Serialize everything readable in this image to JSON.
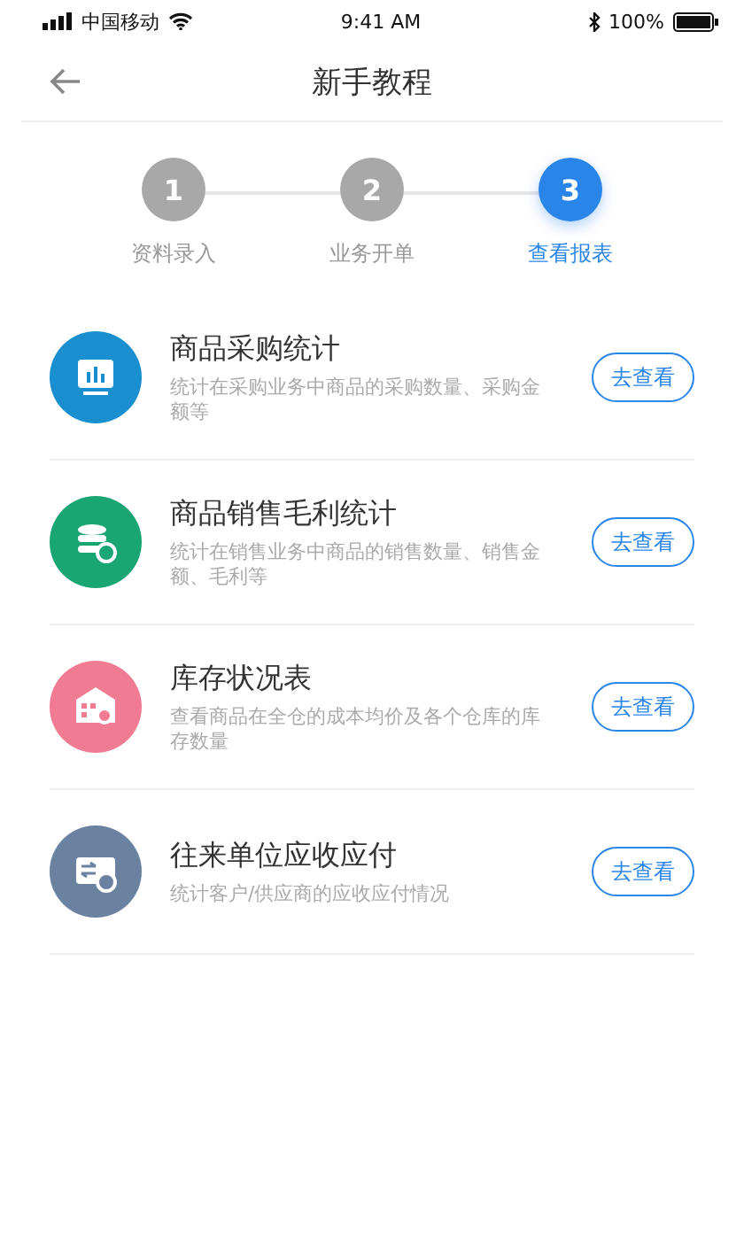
{
  "status_bar": {
    "carrier": "中国移动",
    "time": "9:41 AM",
    "battery": "100%"
  },
  "nav": {
    "title": "新手教程"
  },
  "steps": [
    {
      "number": "1",
      "label": "资料录入",
      "selected": false
    },
    {
      "number": "2",
      "label": "业务开单",
      "selected": false
    },
    {
      "number": "3",
      "label": "查看报表",
      "selected": true
    }
  ],
  "reports": [
    {
      "kind": "purchase",
      "color": "#1a8fcf",
      "title": "商品采购统计",
      "description": "统计在采购业务中商品的采购数量、采购金额等",
      "button": "去查看"
    },
    {
      "kind": "sales",
      "color": "#1aa672",
      "title": "商品销售毛利统计",
      "description": "统计在销售业务中商品的销售数量、销售金额、毛利等",
      "button": "去查看"
    },
    {
      "kind": "inventory",
      "color": "#f07b93",
      "title": "库存状况表",
      "description": "查看商品在全仓的成本均价及各个仓库的库存数量",
      "button": "去查看"
    },
    {
      "kind": "accounts",
      "color": "#6a82a0",
      "title": "往来单位应收应付",
      "description": "统计客户/供应商的应收应付情况",
      "button": "去查看"
    }
  ]
}
